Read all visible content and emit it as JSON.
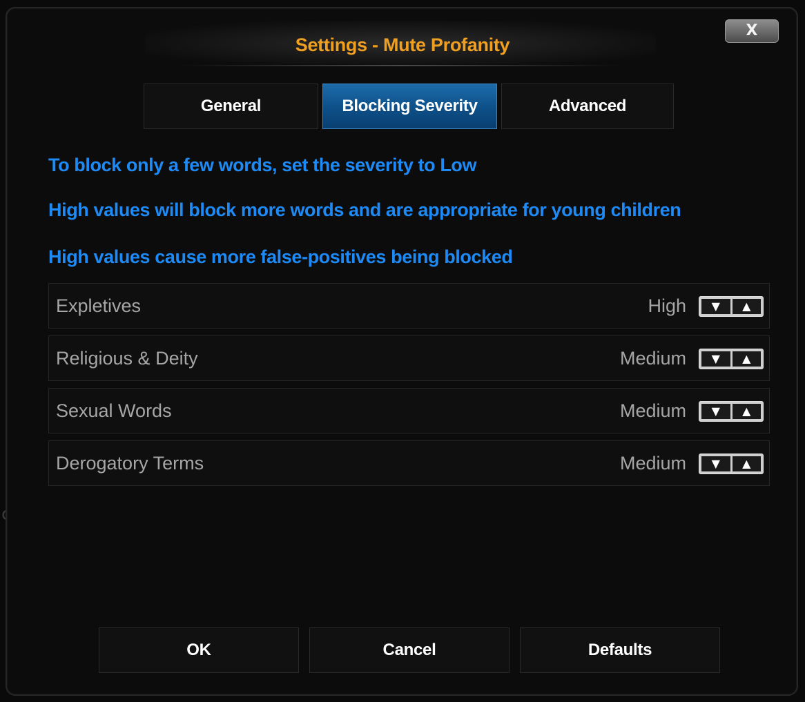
{
  "dialog": {
    "title": "Settings - Mute Profanity",
    "close_label": "X"
  },
  "tabs": [
    {
      "label": "General",
      "selected": false
    },
    {
      "label": "Blocking Severity",
      "selected": true
    },
    {
      "label": "Advanced",
      "selected": false
    }
  ],
  "info_lines": [
    "To block only a few words, set the severity to Low",
    "High values will block more words and are appropriate for young children",
    "High values cause more false-positives being blocked"
  ],
  "settings": [
    {
      "label": "Expletives",
      "value": "High"
    },
    {
      "label": "Religious & Deity",
      "value": "Medium"
    },
    {
      "label": "Sexual Words",
      "value": "Medium"
    },
    {
      "label": "Derogatory Terms",
      "value": "Medium"
    }
  ],
  "spinner": {
    "down_glyph": "▼",
    "up_glyph": "▲"
  },
  "footer": {
    "ok_label": "OK",
    "cancel_label": "Cancel",
    "defaults_label": "Defaults"
  },
  "background_fragment": "c",
  "colors": {
    "title": "#f0a020",
    "info_text": "#1e8af5",
    "selected_tab": "#0d4f88",
    "row_text": "#a6a6a6"
  }
}
